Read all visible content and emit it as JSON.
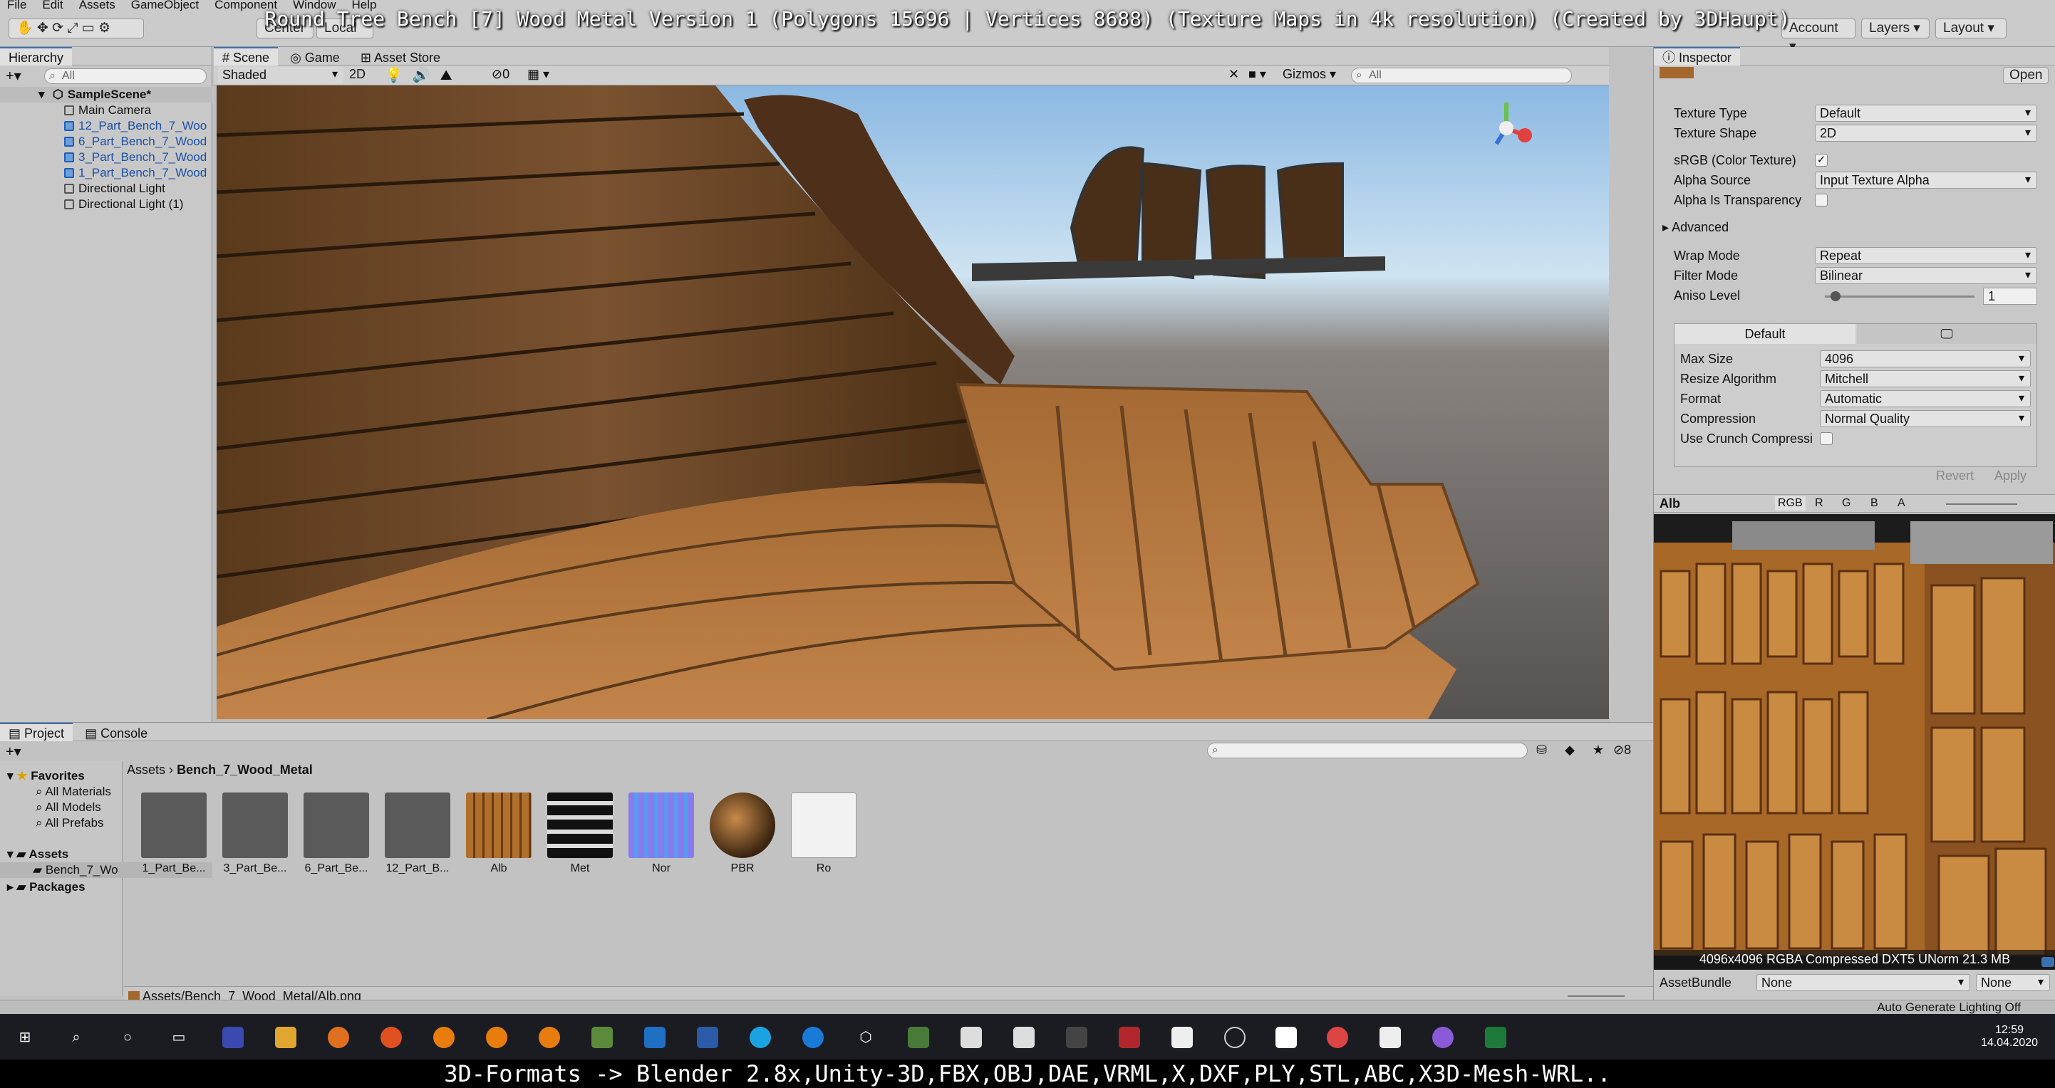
{
  "menu": [
    "File",
    "Edit",
    "Assets",
    "GameObject",
    "Component",
    "Window",
    "Help"
  ],
  "toolbar": {
    "pivot_label": "Center",
    "local_label": "Local",
    "account_label": "Account",
    "layers_label": "Layers",
    "layout_label": "Layout"
  },
  "overlay_title": "Round Tree Bench [7] Wood Metal Version 1 (Polygons 15696 | Vertices 8688) (Texture Maps in 4k resolution) (Created by 3DHaupt)",
  "hierarchy": {
    "tab": "Hierarchy",
    "search_placeholder": "All",
    "scene_name": "SampleScene*",
    "items": [
      {
        "label": "Main Camera",
        "blue": false
      },
      {
        "label": "12_Part_Bench_7_Woo",
        "blue": true
      },
      {
        "label": "6_Part_Bench_7_Wood",
        "blue": true
      },
      {
        "label": "3_Part_Bench_7_Wood",
        "blue": true
      },
      {
        "label": "1_Part_Bench_7_Wood",
        "blue": true
      },
      {
        "label": "Directional Light",
        "blue": false
      },
      {
        "label": "Directional Light (1)",
        "blue": false
      }
    ]
  },
  "scene": {
    "tabs": [
      "Scene",
      "Game",
      "Asset Store"
    ],
    "shading": "Shaded",
    "mode_2d": "2D",
    "hidden_count": "0",
    "gizmos": "Gizmos",
    "search_placeholder": "All"
  },
  "inspector": {
    "tab": "Inspector",
    "open_label": "Open",
    "texture_type_label": "Texture Type",
    "texture_type": "Default",
    "texture_shape_label": "Texture Shape",
    "texture_shape": "2D",
    "srgb_label": "sRGB (Color Texture)",
    "alpha_source_label": "Alpha Source",
    "alpha_source": "Input Texture Alpha",
    "alpha_transp_label": "Alpha Is Transparency",
    "advanced_label": "Advanced",
    "wrap_mode_label": "Wrap Mode",
    "wrap_mode": "Repeat",
    "filter_mode_label": "Filter Mode",
    "filter_mode": "Bilinear",
    "aniso_label": "Aniso Level",
    "aniso_value": "1",
    "platform_tab": "Default",
    "max_size_label": "Max Size",
    "max_size": "4096",
    "resize_label": "Resize Algorithm",
    "resize": "Mitchell",
    "format_label": "Format",
    "format": "Automatic",
    "compression_label": "Compression",
    "compression": "Normal Quality",
    "crunch_label": "Use Crunch Compressi",
    "revert_label": "Revert",
    "apply_label": "Apply",
    "preview_name": "Alb",
    "channels": [
      "RGB",
      "R",
      "G",
      "B",
      "A"
    ],
    "preview_info": "4096x4096  RGBA Compressed DXT5 UNorm   21.3 MB",
    "assetbundle_label": "AssetBundle",
    "assetbundle_value": "None",
    "assetbundle_variant": "None"
  },
  "project": {
    "tabs": [
      "Project",
      "Console"
    ],
    "favorites_label": "Favorites",
    "favorites": [
      "All Materials",
      "All Models",
      "All Prefabs"
    ],
    "assets_label": "Assets",
    "assets_child": "Bench_7_Wo",
    "packages_label": "Packages",
    "breadcrumb_root": "Assets",
    "breadcrumb_folder": "Bench_7_Wood_Metal",
    "hidden_count": "8",
    "items": [
      "1_Part_Be...",
      "3_Part_Be...",
      "6_Part_Be...",
      "12_Part_B...",
      "Alb",
      "Met",
      "Nor",
      "PBR",
      "Ro"
    ],
    "path": "Assets/Bench_7_Wood_Metal/Alb.png"
  },
  "status": {
    "lighting": "Auto Generate Lighting Off"
  },
  "taskbar": {
    "time": "12:59",
    "date": "14.04.2020"
  },
  "subtitle": "3D-Formats -> Blender 2.8x,Unity-3D,FBX,OBJ,DAE,VRML,X,DXF,PLY,STL,ABC,X3D-Mesh-WRL.."
}
